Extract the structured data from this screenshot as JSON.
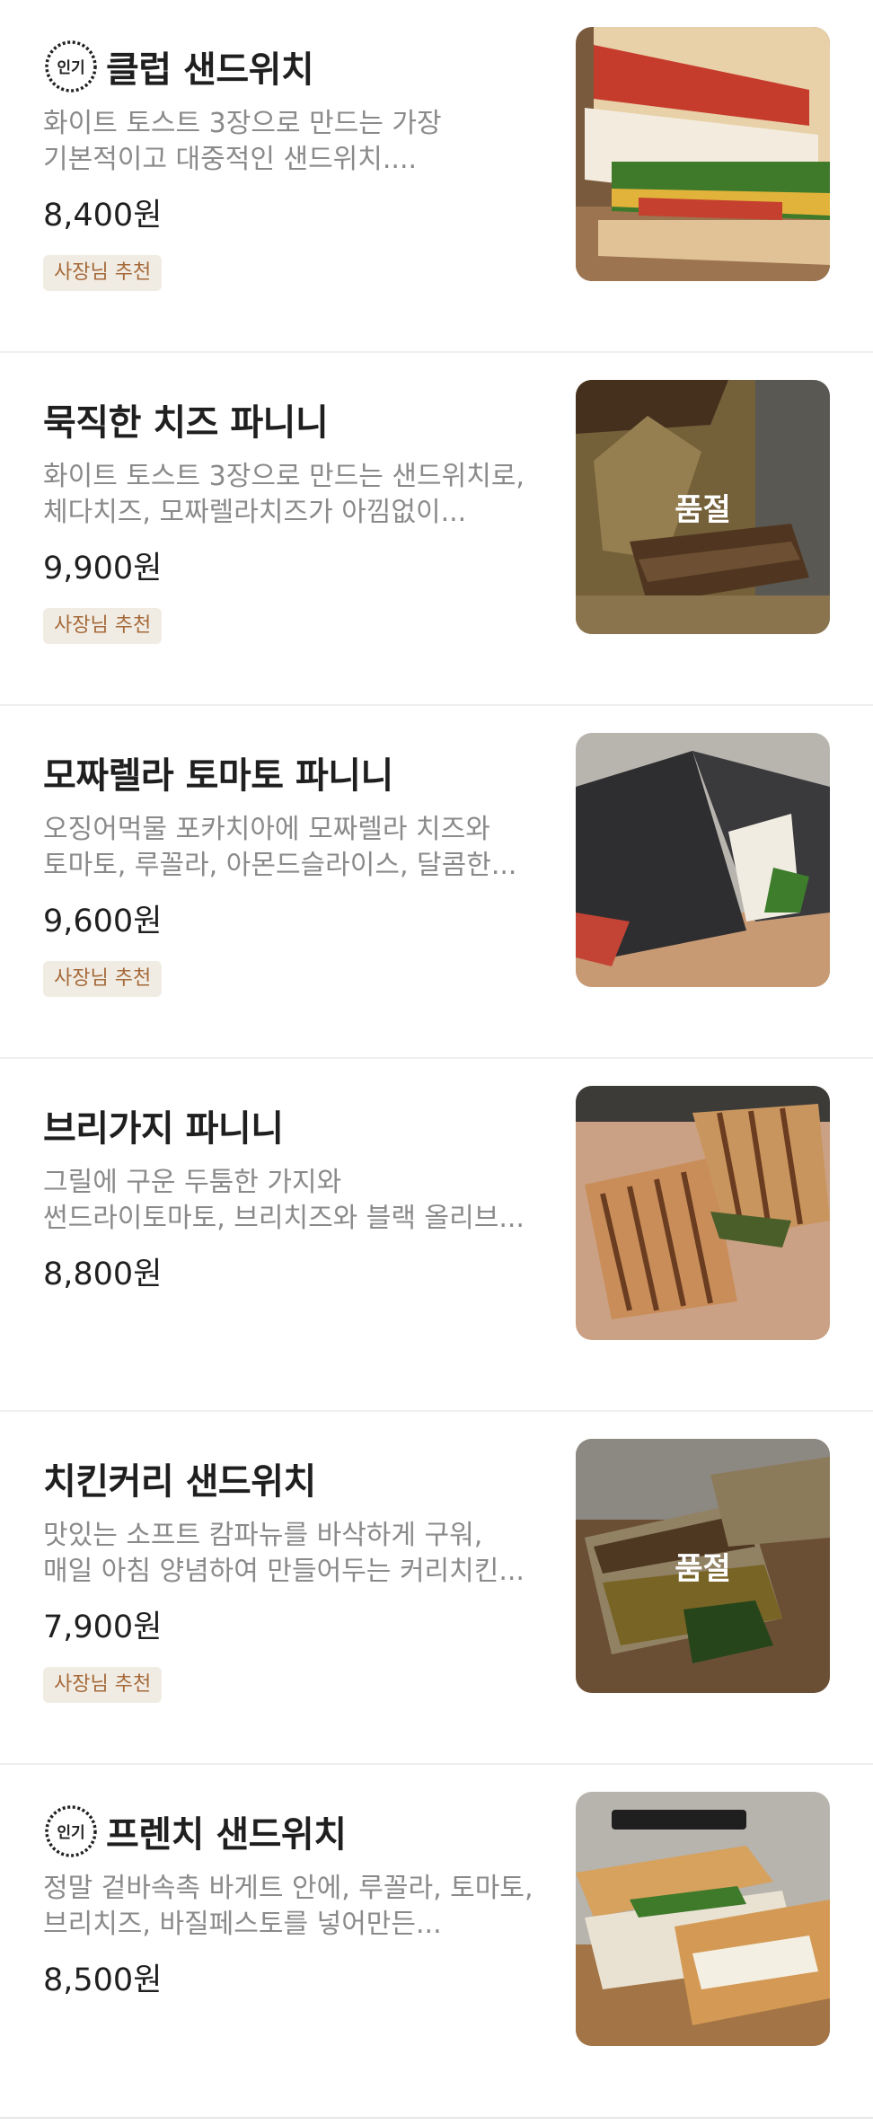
{
  "menu": [
    {
      "name": "클럽 샌드위치",
      "popular": true,
      "popular_label": "인기",
      "desc_line1": "화이트 토스트 3장으로 만드는 가장",
      "desc_line2": "기본적이고 대중적인 샌드위치....",
      "price": "8,400원",
      "badge": "사장님 추천",
      "sold_out": false,
      "image_icon": "club-sandwich-photo"
    },
    {
      "name": "묵직한 치즈 파니니",
      "popular": false,
      "desc_line1": "화이트 토스트 3장으로 만드는 샌드위치로,",
      "desc_line2": "체다치즈, 모짜렐라치즈가 아낌없이...",
      "price": "9,900원",
      "badge": "사장님 추천",
      "sold_out": true,
      "sold_out_label": "품절",
      "image_icon": "cheese-panini-photo"
    },
    {
      "name": "모짜렐라 토마토 파니니",
      "popular": false,
      "desc_line1": "오징어먹물 포카치아에 모짜렐라 치즈와",
      "desc_line2": "토마토, 루꼴라, 아몬드슬라이스, 달콤한...",
      "price": "9,600원",
      "badge": "사장님 추천",
      "sold_out": false,
      "image_icon": "mozzarella-panini-photo"
    },
    {
      "name": "브리가지 파니니",
      "popular": false,
      "desc_line1": "그릴에 구운 두툼한 가지와",
      "desc_line2": "썬드라이토마토, 브리치즈와 블랙 올리브...",
      "price": "8,800원",
      "badge": "",
      "sold_out": false,
      "image_icon": "brie-eggplant-panini-photo"
    },
    {
      "name": "치킨커리 샌드위치",
      "popular": false,
      "desc_line1": "맛있는 소프트 캄파뉴를 바삭하게 구워,",
      "desc_line2": "매일 아침 양념하여 만들어두는 커리치킨...",
      "price": "7,900원",
      "badge": "사장님 추천",
      "sold_out": true,
      "sold_out_label": "품절",
      "image_icon": "chicken-curry-sandwich-photo"
    },
    {
      "name": "프렌치 샌드위치",
      "popular": true,
      "popular_label": "인기",
      "desc_line1": "정말 겉바속촉 바게트 안에, 루꼴라, 토마토,",
      "desc_line2": "브리치즈, 바질페스토를 넣어만든...",
      "price": "8,500원",
      "badge": "",
      "sold_out": false,
      "image_icon": "french-baguette-sandwich-photo"
    }
  ],
  "colors": {
    "badge_bg": "#f1ece3",
    "badge_text": "#a5693a",
    "desc_text": "#8a8a8a",
    "divider": "#efefef"
  }
}
